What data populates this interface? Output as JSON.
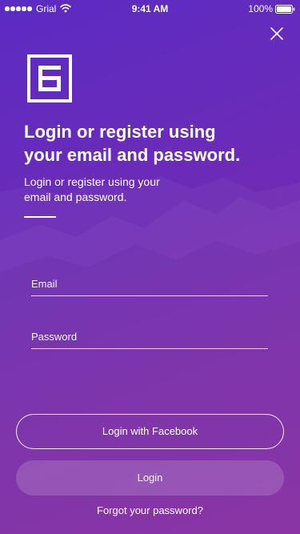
{
  "status_bar": {
    "carrier": "Grial",
    "time": "9:41 AM",
    "battery": "100%"
  },
  "icons": {
    "close": "close-icon",
    "wifi": "wifi-icon",
    "battery": "battery-icon",
    "logo": "brand-logo"
  },
  "header": {
    "title_line1": "Login or register using",
    "title_line2": "your email and password.",
    "subtitle_line1": "Login or register using your",
    "subtitle_line2": "email and password."
  },
  "form": {
    "email_placeholder": "Email",
    "email_value": "",
    "password_placeholder": "Password",
    "password_value": ""
  },
  "actions": {
    "facebook_label": "Login with Facebook",
    "login_label": "Login",
    "forgot_label": "Forgot your password?"
  },
  "colors": {
    "background_top": "#5b2bc4",
    "background_bottom": "#8a2aa4",
    "text": "#ffffff"
  }
}
